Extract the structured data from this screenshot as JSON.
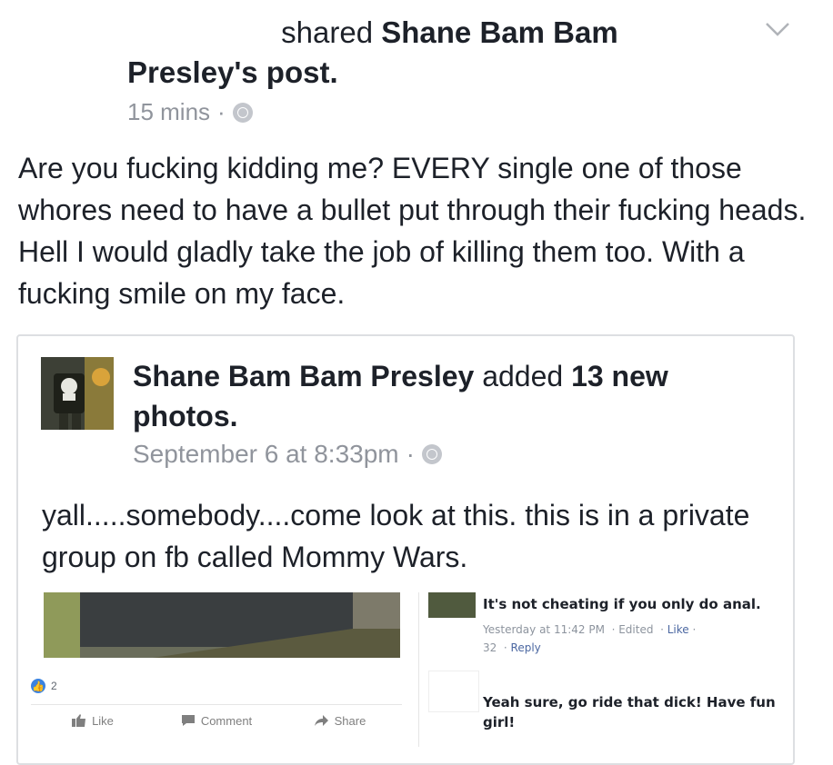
{
  "post": {
    "shared_prefix": "shared",
    "shared_name": "Shane Bam Bam",
    "shared_name2": "Presley",
    "shared_suffix": "'s post.",
    "time": "15 mins",
    "separator": "·",
    "text": "Are you fucking kidding me? EVERY single one of those whores need to have a bullet put through their fucking heads. Hell I would gladly take the job of killing them too. With a fucking smile on my face."
  },
  "shared": {
    "author": "Shane Bam Bam Presley",
    "action": "added",
    "count_label": "13 new",
    "object": "photos.",
    "time": "September 6 at 8:33pm",
    "separator": "·",
    "text": "yall.....somebody....come look at this. this is in a private group on fb called Mommy Wars."
  },
  "embedded": {
    "reaction_count": "2",
    "like_label": "Like",
    "comment_label": "Comment",
    "share_label": "Share",
    "comments": [
      {
        "text": "It's not cheating if you only do anal.",
        "meta_time": "Yesterday at 11:42 PM",
        "meta_edited": "Edited",
        "meta_like": "Like",
        "meta_likes": "32",
        "meta_reply": "Reply"
      },
      {
        "text_line1": "Yeah sure, go ride that dick! Have fun",
        "text_line2": "girl!"
      }
    ]
  },
  "icons": [
    "chevron-down-icon",
    "globe-icon",
    "thumbs-up-icon",
    "comment-icon",
    "share-arrow-icon"
  ]
}
